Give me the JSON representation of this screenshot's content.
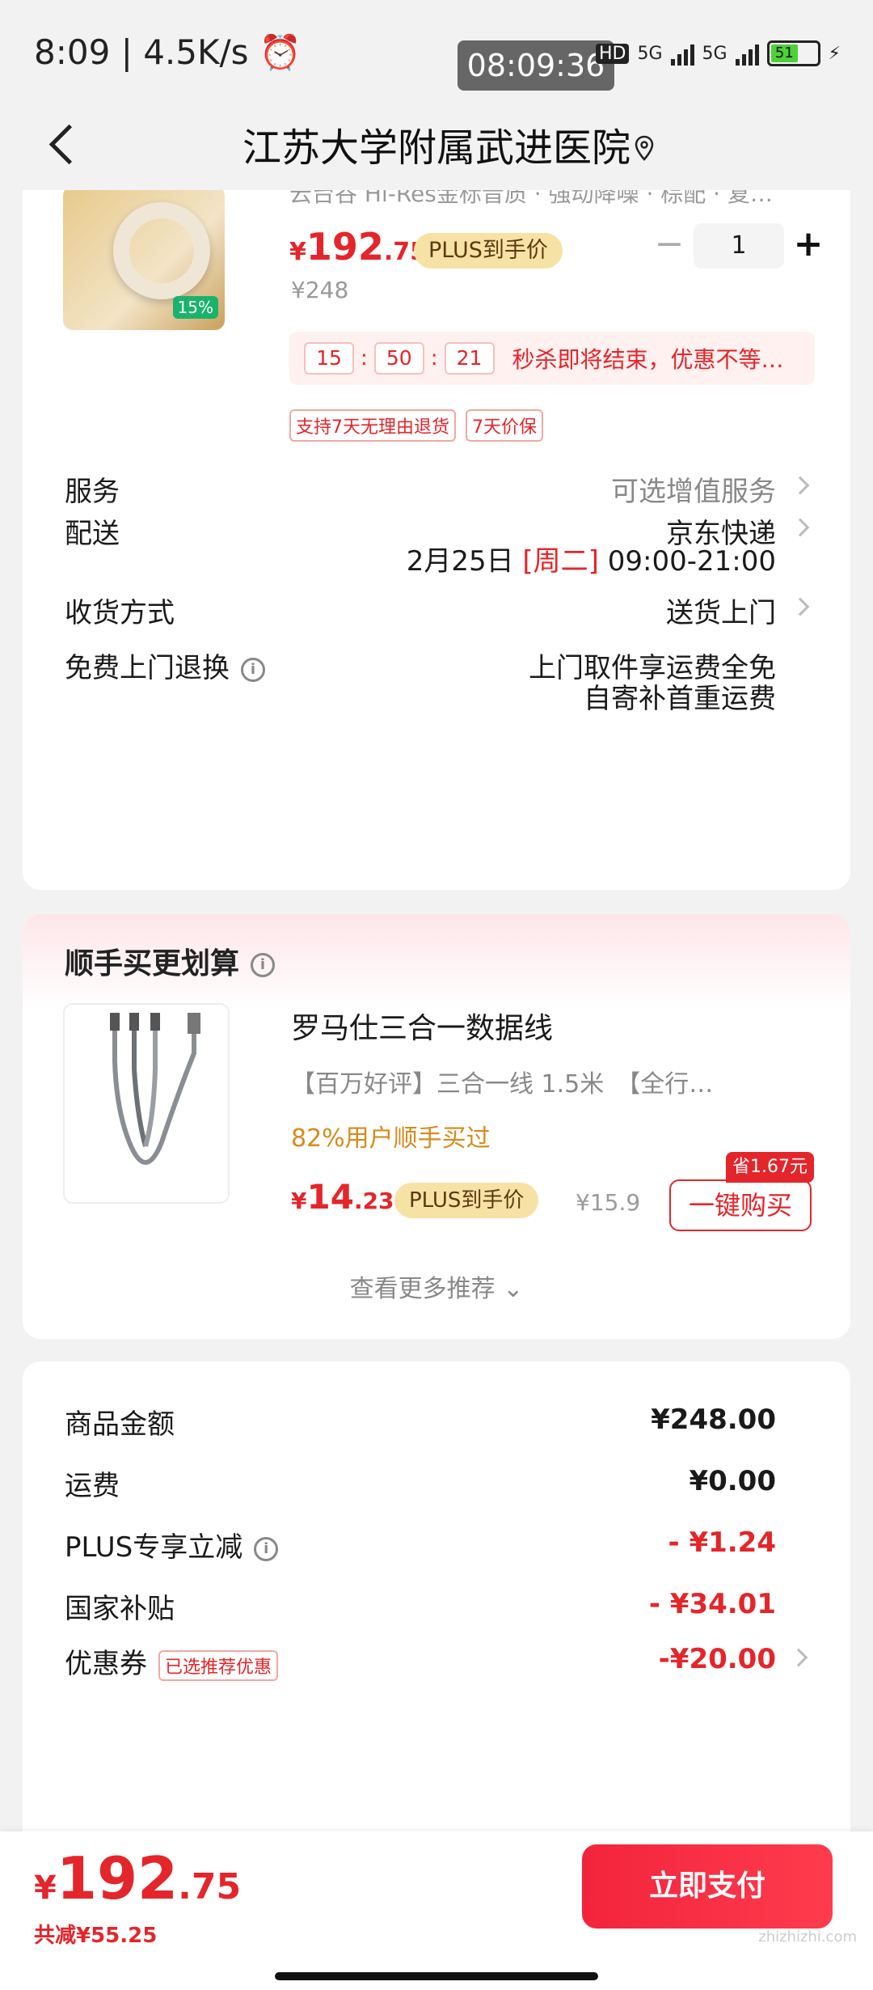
{
  "status_bar": {
    "time": "8:09",
    "speed": "| 4.5K/s",
    "clock_overlay": "08:09:36",
    "hd_label": "HD",
    "net1": "5G",
    "net2": "5G",
    "battery": "51"
  },
  "header": {
    "title": "江苏大学附属武进医院"
  },
  "product": {
    "subtitle": "云台谷 Hi-Res金标音质 · 强动降噪 · 棕配 · 复…",
    "price_symbol": "¥",
    "price_int": "192",
    "price_dec": ".75",
    "plus_label": "PLUS到手价",
    "original_price": "¥248",
    "quantity": "1",
    "minus": "−",
    "plus": "+",
    "countdown": {
      "h": "15",
      "m": "50",
      "s": "21",
      "sep": ":"
    },
    "countdown_text": "秒杀即将结束，优惠不等…",
    "image_badge": "15%",
    "tags": [
      "支持7天无理由退货",
      "7天价保"
    ]
  },
  "rows": {
    "service_label": "服务",
    "service_value": "可选增值服务",
    "delivery_label": "配送",
    "delivery_value": "京东快递",
    "delivery_date": "2月25日",
    "delivery_weekday": "[周二]",
    "delivery_time": "09:00-21:00",
    "receive_label": "收货方式",
    "receive_value": "送货上门",
    "return_label": "免费上门退换",
    "return_value_1": "上门取件享运费全免",
    "return_value_2": "自寄补首重运费"
  },
  "recommend": {
    "title": "顺手买更划算",
    "name": "罗马仕三合一数据线",
    "desc": "【百万好评】三合一线 1.5米　【全行…",
    "bought": "82%用户顺手买过",
    "price_symbol": "¥",
    "price_int": "14",
    "price_dec": ".23",
    "plus_label": "PLUS到手价",
    "original_price": "¥15.9",
    "buy_label": "一键购买",
    "save_badge": "省1.67元",
    "more_label": "查看更多推荐 ⌄"
  },
  "amounts": {
    "goods_label": "商品金额",
    "goods_value": "¥248.00",
    "shipping_label": "运费",
    "shipping_value": "¥0.00",
    "plus_label": "PLUS专享立减",
    "plus_value": "- ¥1.24",
    "subsidy_label": "国家补贴",
    "subsidy_value": "- ¥34.01",
    "coupon_label": "优惠券",
    "coupon_tag": "已选推荐优惠",
    "coupon_value": "-¥20.00"
  },
  "bottom": {
    "total_symbol": "¥",
    "total_int": "192",
    "total_dec": ".75",
    "saved": "共减¥55.25",
    "pay_label": "立即支付",
    "watermark": "zhizhizhi.com"
  },
  "colors": {
    "accent": "#e4252a",
    "plus_pill": "#f7e2a6",
    "bought": "#d68a1c"
  }
}
